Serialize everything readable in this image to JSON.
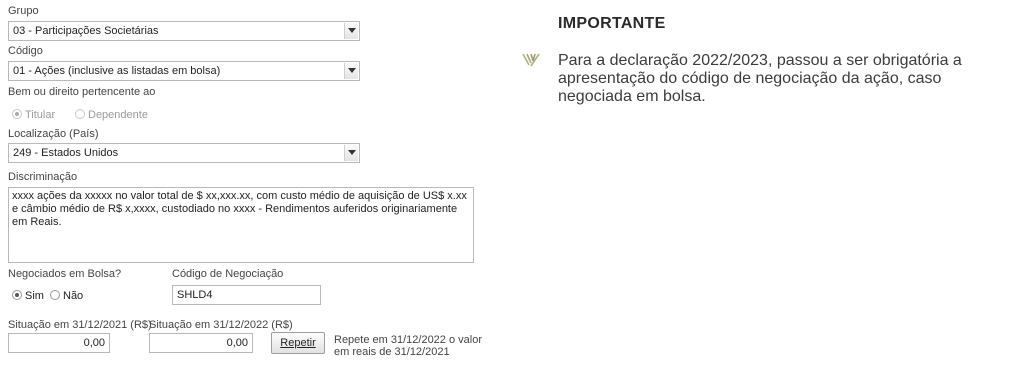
{
  "form": {
    "grupo_label": "Grupo",
    "grupo_value": "03 - Participações Societárias",
    "codigo_label": "Código",
    "codigo_value": "01 - Ações (inclusive as listadas em bolsa)",
    "bem_label": "Bem ou direito pertencente ao",
    "titular_label": "Titular",
    "dependente_label": "Dependente",
    "localizacao_label": "Localização (País)",
    "localizacao_value": "249 - Estados Unidos",
    "discriminacao_label": "Discriminação",
    "discriminacao_value": "xxxx ações da xxxxx no valor total de $ xx,xxx.xx, com custo médio de aquisição de US$ x.xx e câmbio médio de R$ x,xxxx, custodiado no xxxx - Rendimentos auferidos originariamente em Reais.",
    "negociados_label": "Negociados em Bolsa?",
    "sim_label": "Sim",
    "nao_label": "Não",
    "codigo_negociacao_label": "Código de Negociação",
    "codigo_negociacao_value": "SHLD4",
    "situacao_2021_label": "Situação em 31/12/2021 (R$)",
    "situacao_2021_value": "0,00",
    "situacao_2022_label": "Situação em 31/12/2022 (R$)",
    "situacao_2022_value": "0,00",
    "repetir_label": "Repetir",
    "repete_note_line1": "Repete em 31/12/2022 o valor",
    "repete_note_line2": "em reais de 31/12/2021"
  },
  "aside": {
    "title": "IMPORTANTE",
    "text": "Para a declaração 2022/2023, passou a ser obrigatória a apresentação do código de negociação da ação, caso negociada em bolsa.",
    "accent_color": "#a8a878"
  },
  "icons": {
    "dropdown": "chevron-down-icon",
    "bullet": "chevron-bullet-icon"
  }
}
